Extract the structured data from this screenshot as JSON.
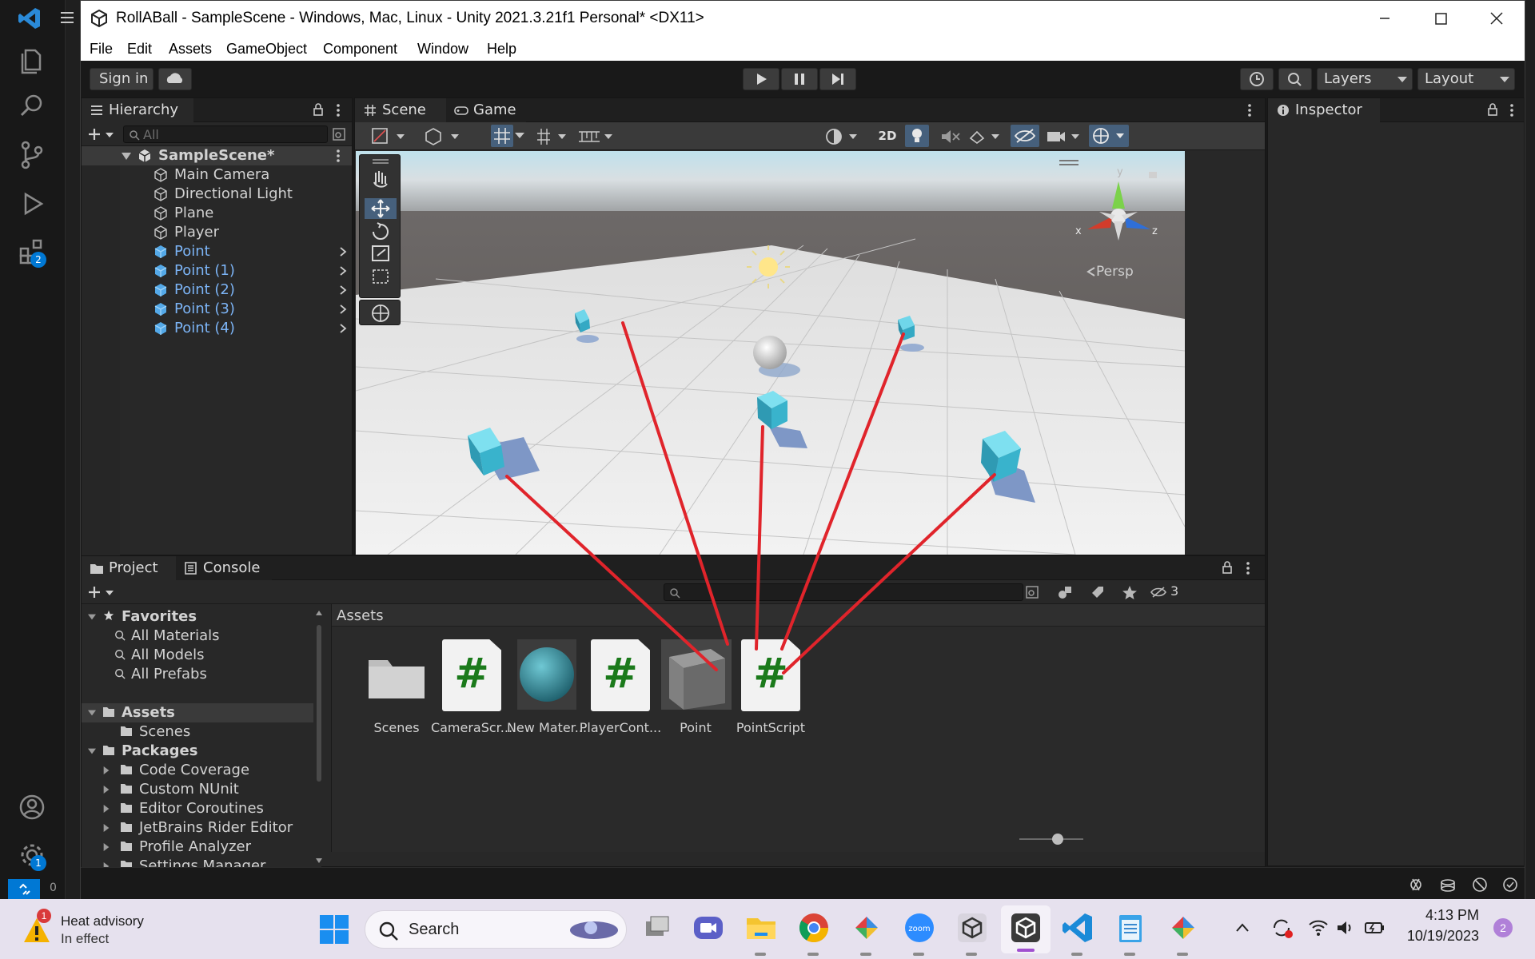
{
  "vscode": {
    "badges": {
      "extensions": "2",
      "settings": "1"
    },
    "status": {
      "problems": "0"
    }
  },
  "window": {
    "title": "RollABall - SampleScene - Windows, Mac, Linux - Unity 2021.3.21f1 Personal* <DX11>"
  },
  "menu": [
    "File",
    "Edit",
    "Assets",
    "GameObject",
    "Component",
    "Window",
    "Help"
  ],
  "toolbar": {
    "sign_in": "Sign in",
    "layers": "Layers",
    "layout": "Layout"
  },
  "hierarchy": {
    "tab": "Hierarchy",
    "search_placeholder": "All",
    "scene": "SampleScene*",
    "items": [
      {
        "label": "Main Camera",
        "prefab": false
      },
      {
        "label": "Directional Light",
        "prefab": false
      },
      {
        "label": "Plane",
        "prefab": false
      },
      {
        "label": "Player",
        "prefab": false
      },
      {
        "label": "Point",
        "prefab": true
      },
      {
        "label": "Point (1)",
        "prefab": true
      },
      {
        "label": "Point (2)",
        "prefab": true
      },
      {
        "label": "Point (3)",
        "prefab": true
      },
      {
        "label": "Point (4)",
        "prefab": true
      }
    ]
  },
  "scene_view": {
    "tabs": [
      "Scene",
      "Game"
    ],
    "btn_2d": "2D",
    "persp": "Persp",
    "axes": {
      "x": "x",
      "y": "y",
      "z": "z"
    }
  },
  "inspector": {
    "tab": "Inspector"
  },
  "project": {
    "tabs": [
      "Project",
      "Console"
    ],
    "hidden_count": "3",
    "favorites": {
      "label": "Favorites",
      "items": [
        "All Materials",
        "All Models",
        "All Prefabs"
      ]
    },
    "assets_root": {
      "label": "Assets",
      "items": [
        "Scenes"
      ]
    },
    "packages": {
      "label": "Packages",
      "items": [
        "Code Coverage",
        "Custom NUnit",
        "Editor Coroutines",
        "JetBrains Rider Editor",
        "Profile Analyzer",
        "Settings Manager"
      ]
    },
    "assets_header": "Assets",
    "assets": [
      {
        "name": "Scenes",
        "kind": "folder"
      },
      {
        "name": "CameraScr...",
        "kind": "script"
      },
      {
        "name": "New Mater...",
        "kind": "material"
      },
      {
        "name": "PlayerCont...",
        "kind": "script"
      },
      {
        "name": "Point",
        "kind": "prefab"
      },
      {
        "name": "PointScript",
        "kind": "script"
      }
    ]
  },
  "taskbar": {
    "weather_title": "Heat advisory",
    "weather_sub": "In effect",
    "weather_badge": "1",
    "search": "Search",
    "time": "4:13 PM",
    "date": "10/19/2023",
    "notif": "2"
  },
  "colors": {
    "annotation_line": "#e0242b",
    "prefab_blue": "#7cb4f6",
    "cube": "#4fc8df"
  }
}
